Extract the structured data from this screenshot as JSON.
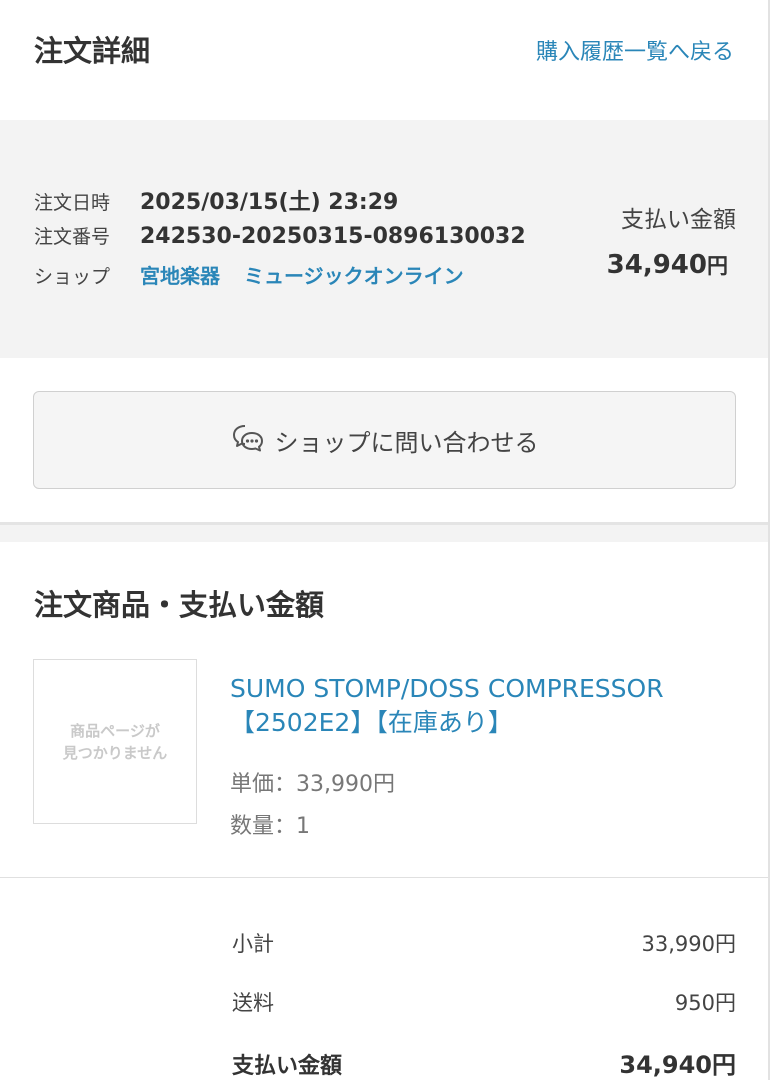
{
  "header": {
    "title": "注文詳細",
    "back_link": "購入履歴一覧へ戻る"
  },
  "order_info": {
    "date_label": "注文日時",
    "date_value": "2025/03/15(土) 23:29",
    "number_label": "注文番号",
    "number_value": "242530-20250315-0896130032",
    "shop_label": "ショップ",
    "shop_name": "宮地楽器",
    "shop_subname": "ミュージックオンライン",
    "payment_label": "支払い金額",
    "payment_amount": "34,940",
    "payment_unit": "円"
  },
  "contact_button": {
    "label": "ショップに問い合わせる",
    "icon": "chat-bubbles-icon"
  },
  "items_section": {
    "title": "注文商品・支払い金額",
    "item": {
      "thumbnail_text": "商品ページが\n見つかりません",
      "name": "SUMO STOMP/DOSS COMPRESSOR【2502E2】【在庫あり】",
      "unit_price": "単価：33,990円",
      "quantity": "数量：1"
    }
  },
  "summary": {
    "subtotal_label": "小計",
    "subtotal_value": "33,990円",
    "shipping_label": "送料",
    "shipping_value": "950円",
    "total_label": "支払い金額",
    "total_value": "34,940円"
  },
  "colors": {
    "link": "#2a86b8",
    "panel_bg": "#f3f3f3",
    "text": "#333333"
  }
}
